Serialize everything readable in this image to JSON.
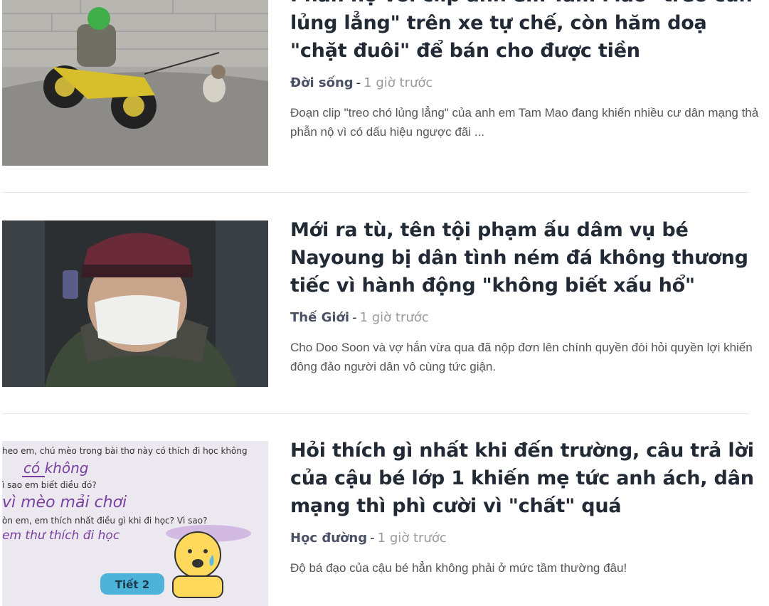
{
  "articles": [
    {
      "title": "Phẫn nộ với clip anh em Tam Mao \"treo cún lủng lẳng\" trên xe tự chế, còn hăm doạ \"chặt đuôi\" để bán cho được tiền",
      "category": "Đời sống",
      "separator": "-",
      "time": "1 giờ trước",
      "description": "Đoạn clip \"treo chó lủng lẳng\" của anh em Tam Mao đang khiến nhiều cư dân mạng thả phẫn nộ vì có dấu hiệu ngược đãi ..."
    },
    {
      "title": "Mới ra tù, tên tội phạm ấu dâm vụ bé Nayoung bị dân tình ném đá không thương tiếc vì hành động \"không biết xấu hổ\"",
      "category": "Thế Giới",
      "separator": "-",
      "time": "1 giờ trước",
      "description": "Cho Doo Soon và vợ hắn vừa qua đã nộp đơn lên chính quyền đòi hỏi quyền lợi khiến đông đảo người dân vô cùng tức giận."
    },
    {
      "title": "Hỏi thích gì nhất khi đến trường, câu trả lời của cậu bé lớp 1 khiến mẹ tức anh ách, dân mạng thì phì cười vì \"chất\" quá",
      "category": "Học đường",
      "separator": "-",
      "time": "1 giờ trước",
      "description": "Độ bá đạo của cậu bé hẳn không phải ở mức tầm thường đâu!",
      "image_text": {
        "line1": "heo em, chú mèo trong bài thơ này có thích đi học không",
        "answer1": "có không",
        "line2": "ì sao em biết điều đó?",
        "answer2": "vì mèo mải chơi",
        "line3": "òn em, em thích nhất điều gì khi đi học? Vì sao?",
        "answer3": "em thư thích đi học",
        "badge": "Tiết 2"
      }
    }
  ],
  "colors": {
    "title": "#222a36",
    "category": "#4b5266",
    "time": "#9a9a9a",
    "description": "#555555",
    "divider": "#e6e6e6",
    "handwriting": "#7a3fa0"
  }
}
